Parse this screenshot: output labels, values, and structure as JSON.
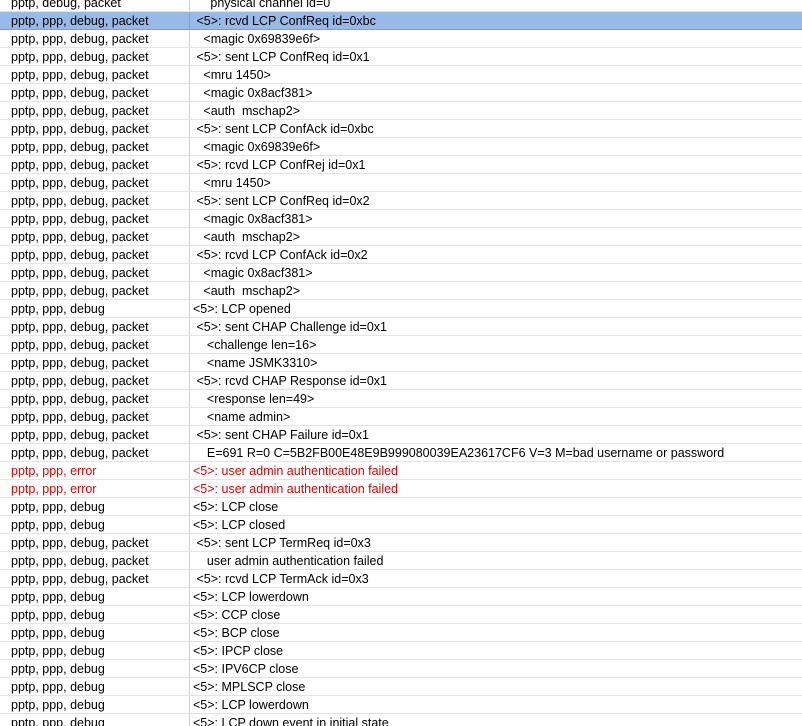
{
  "log": {
    "rows": [
      {
        "tags": "pptp, debug, packet",
        "msg": "     physical channel id=0",
        "level": "partial"
      },
      {
        "tags": "pptp, ppp, debug, packet",
        "msg": " <5>: rcvd LCP ConfReq id=0xbc",
        "level": "selected"
      },
      {
        "tags": "pptp, ppp, debug, packet",
        "msg": "   <magic 0x69839e6f>",
        "level": "normal"
      },
      {
        "tags": "pptp, ppp, debug, packet",
        "msg": " <5>: sent LCP ConfReq id=0x1",
        "level": "normal"
      },
      {
        "tags": "pptp, ppp, debug, packet",
        "msg": "   <mru 1450>",
        "level": "normal"
      },
      {
        "tags": "pptp, ppp, debug, packet",
        "msg": "   <magic 0x8acf381>",
        "level": "normal"
      },
      {
        "tags": "pptp, ppp, debug, packet",
        "msg": "   <auth  mschap2>",
        "level": "normal"
      },
      {
        "tags": "pptp, ppp, debug, packet",
        "msg": " <5>: sent LCP ConfAck id=0xbc",
        "level": "normal"
      },
      {
        "tags": "pptp, ppp, debug, packet",
        "msg": "   <magic 0x69839e6f>",
        "level": "normal"
      },
      {
        "tags": "pptp, ppp, debug, packet",
        "msg": " <5>: rcvd LCP ConfRej id=0x1",
        "level": "normal"
      },
      {
        "tags": "pptp, ppp, debug, packet",
        "msg": "   <mru 1450>",
        "level": "normal"
      },
      {
        "tags": "pptp, ppp, debug, packet",
        "msg": " <5>: sent LCP ConfReq id=0x2",
        "level": "normal"
      },
      {
        "tags": "pptp, ppp, debug, packet",
        "msg": "   <magic 0x8acf381>",
        "level": "normal"
      },
      {
        "tags": "pptp, ppp, debug, packet",
        "msg": "   <auth  mschap2>",
        "level": "normal"
      },
      {
        "tags": "pptp, ppp, debug, packet",
        "msg": " <5>: rcvd LCP ConfAck id=0x2",
        "level": "normal"
      },
      {
        "tags": "pptp, ppp, debug, packet",
        "msg": "   <magic 0x8acf381>",
        "level": "normal"
      },
      {
        "tags": "pptp, ppp, debug, packet",
        "msg": "   <auth  mschap2>",
        "level": "normal"
      },
      {
        "tags": "pptp, ppp, debug",
        "msg": "<5>: LCP opened",
        "level": "normal"
      },
      {
        "tags": "pptp, ppp, debug, packet",
        "msg": " <5>: sent CHAP Challenge id=0x1",
        "level": "normal"
      },
      {
        "tags": "pptp, ppp, debug, packet",
        "msg": "    <challenge len=16>",
        "level": "normal"
      },
      {
        "tags": "pptp, ppp, debug, packet",
        "msg": "    <name JSMK3310>",
        "level": "normal"
      },
      {
        "tags": "pptp, ppp, debug, packet",
        "msg": " <5>: rcvd CHAP Response id=0x1",
        "level": "normal"
      },
      {
        "tags": "pptp, ppp, debug, packet",
        "msg": "    <response len=49>",
        "level": "normal"
      },
      {
        "tags": "pptp, ppp, debug, packet",
        "msg": "    <name admin>",
        "level": "normal"
      },
      {
        "tags": "pptp, ppp, debug, packet",
        "msg": " <5>: sent CHAP Failure id=0x1",
        "level": "normal"
      },
      {
        "tags": "pptp, ppp, debug, packet",
        "msg": "    E=691 R=0 C=5B2FB00E48E9B999080039EA23617CF6 V=3 M=bad username or password",
        "level": "normal"
      },
      {
        "tags": "pptp, ppp, error",
        "msg": "<5>: user admin authentication failed",
        "level": "error"
      },
      {
        "tags": "pptp, ppp, error",
        "msg": "<5>: user admin authentication failed",
        "level": "error"
      },
      {
        "tags": "pptp, ppp, debug",
        "msg": "<5>: LCP close",
        "level": "normal"
      },
      {
        "tags": "pptp, ppp, debug",
        "msg": "<5>: LCP closed",
        "level": "normal"
      },
      {
        "tags": "pptp, ppp, debug, packet",
        "msg": " <5>: sent LCP TermReq id=0x3",
        "level": "normal"
      },
      {
        "tags": "pptp, ppp, debug, packet",
        "msg": "    user admin authentication failed",
        "level": "normal"
      },
      {
        "tags": "pptp, ppp, debug, packet",
        "msg": " <5>: rcvd LCP TermAck id=0x3",
        "level": "normal"
      },
      {
        "tags": "pptp, ppp, debug",
        "msg": "<5>: LCP lowerdown",
        "level": "normal"
      },
      {
        "tags": "pptp, ppp, debug",
        "msg": "<5>: CCP close",
        "level": "normal"
      },
      {
        "tags": "pptp, ppp, debug",
        "msg": "<5>: BCP close",
        "level": "normal"
      },
      {
        "tags": "pptp, ppp, debug",
        "msg": "<5>: IPCP close",
        "level": "normal"
      },
      {
        "tags": "pptp, ppp, debug",
        "msg": "<5>: IPV6CP close",
        "level": "normal"
      },
      {
        "tags": "pptp, ppp, debug",
        "msg": "<5>: MPLSCP close",
        "level": "normal"
      },
      {
        "tags": "pptp, ppp, debug",
        "msg": "<5>: LCP lowerdown",
        "level": "normal"
      },
      {
        "tags": "pptp, ppp, debug",
        "msg": "<5>: LCP down event in initial state",
        "level": "normal"
      }
    ]
  },
  "colors": {
    "selected_row": "#99b9e6",
    "error_text": "#e00000",
    "grid_line": "#e3e3e3"
  }
}
